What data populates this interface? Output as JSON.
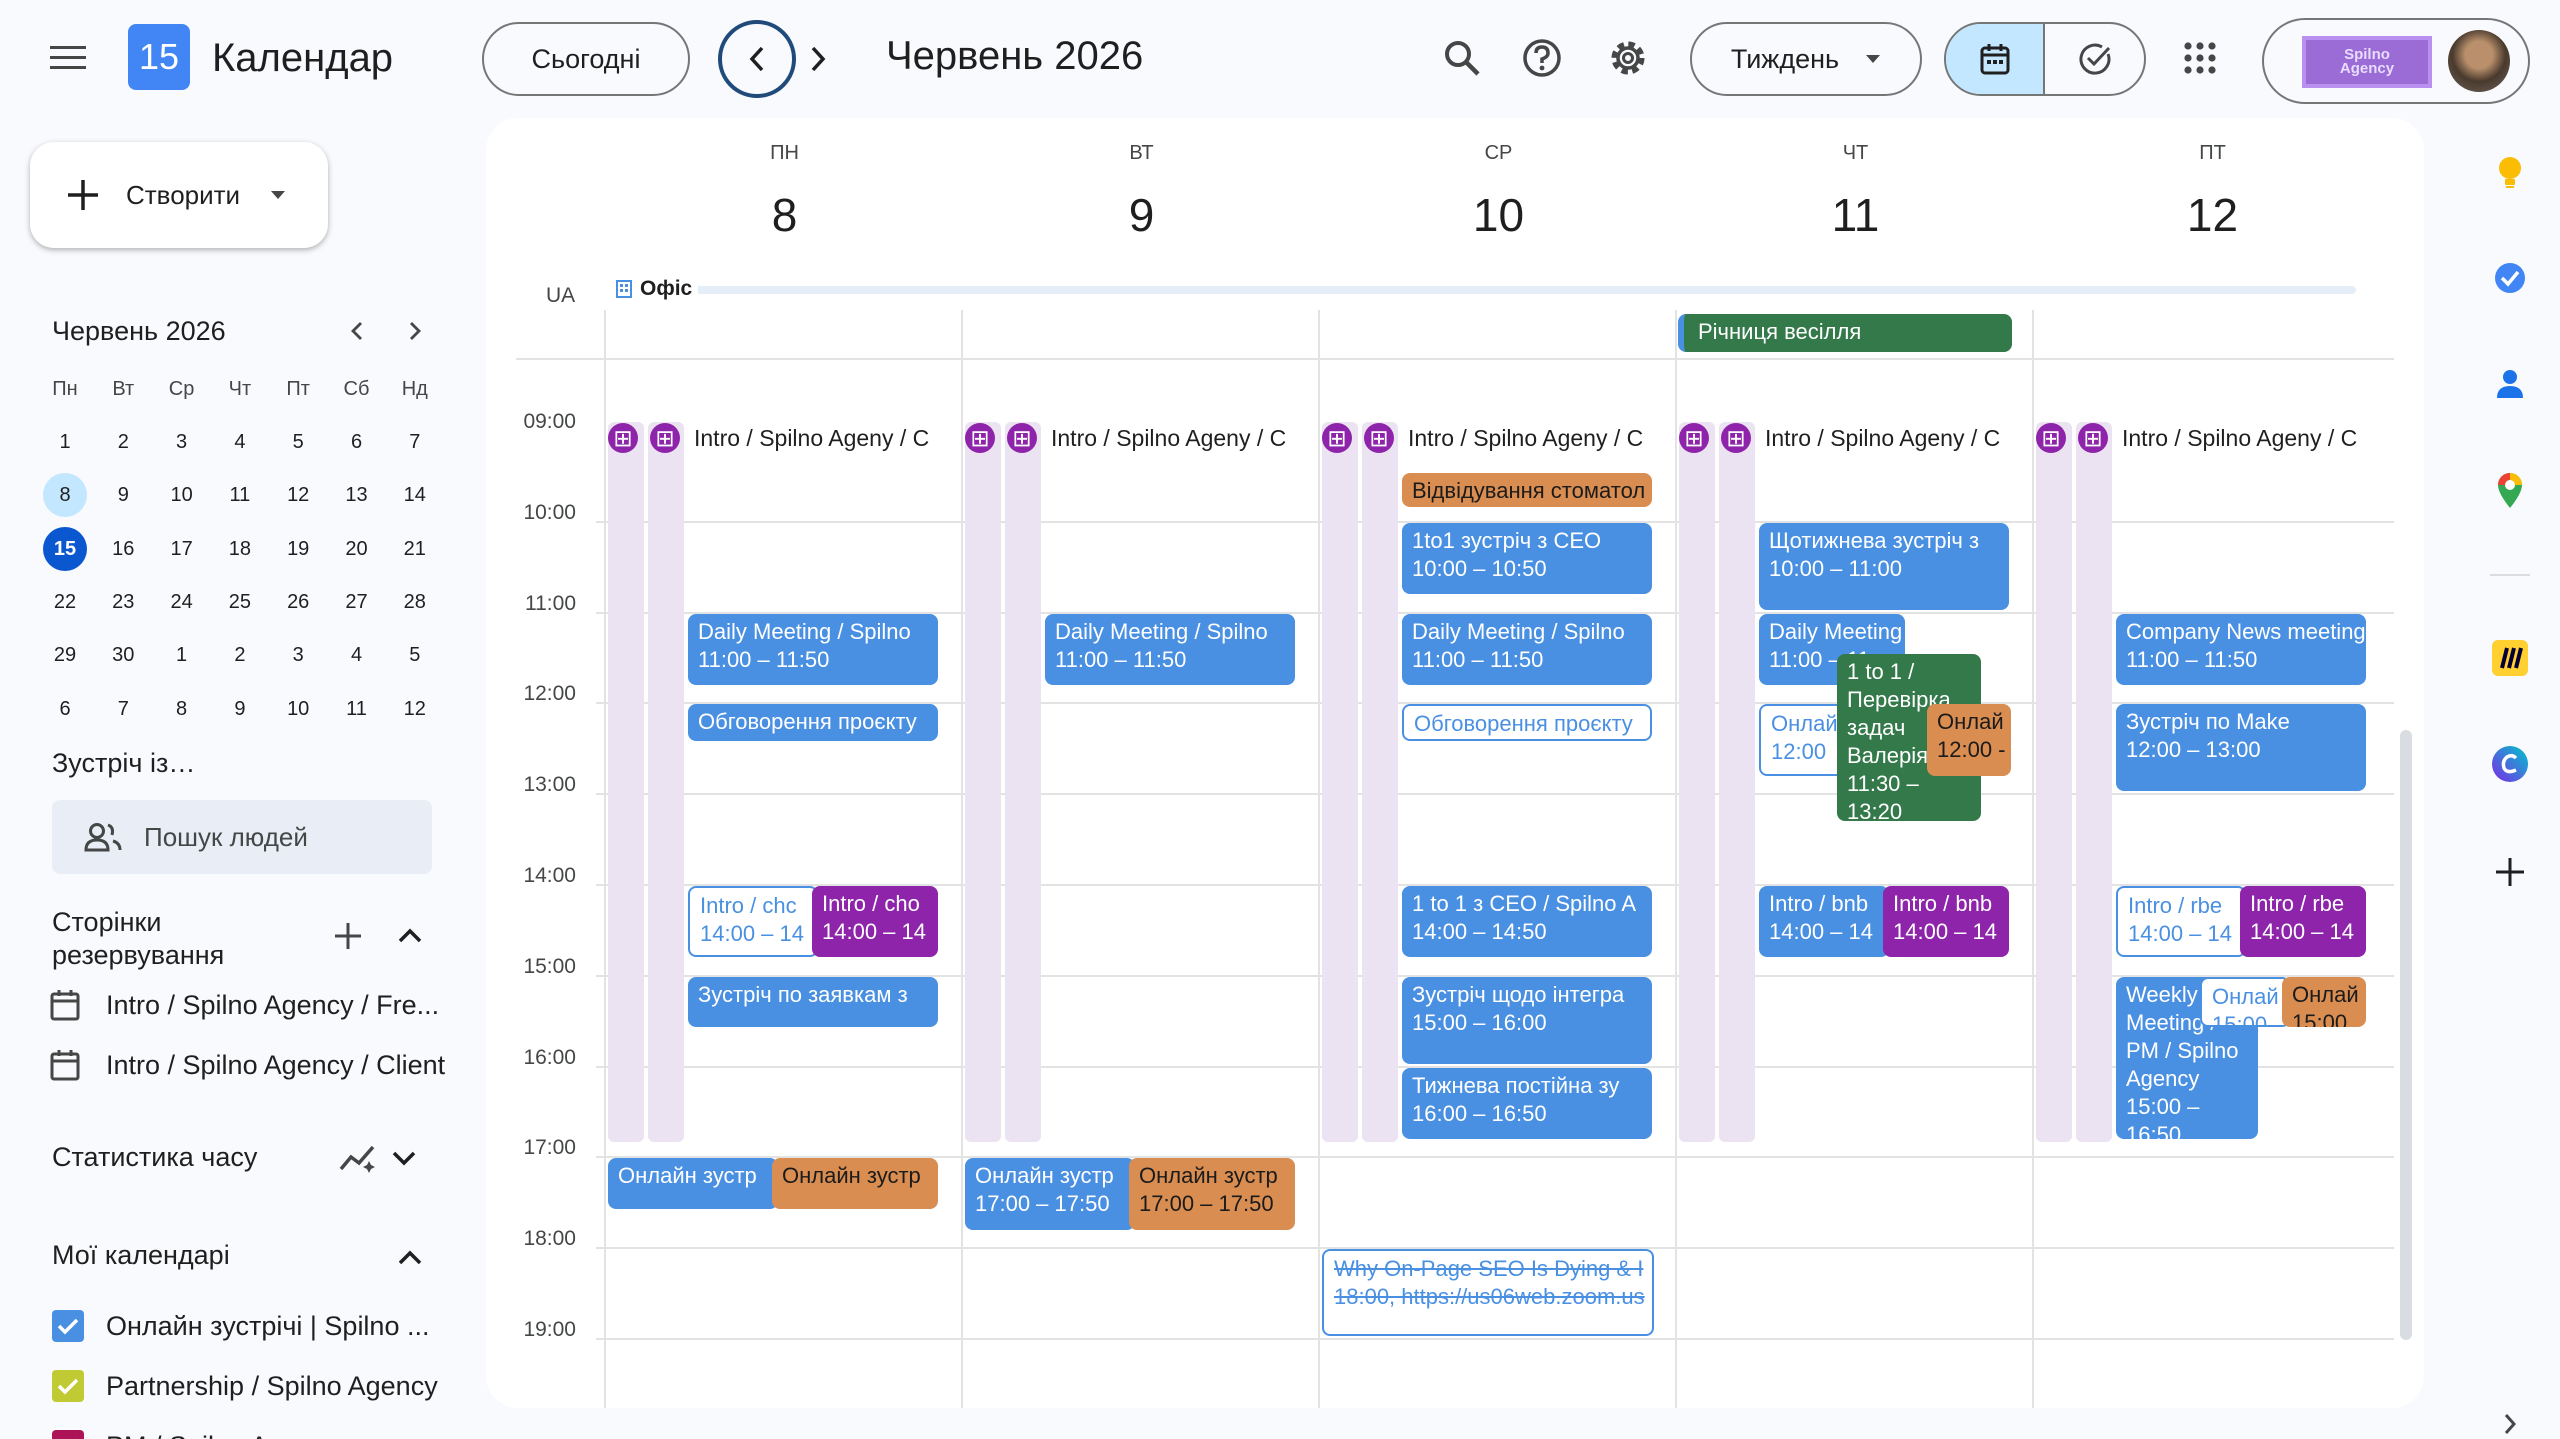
{
  "header": {
    "app_title": "Календар",
    "logo_day": "15",
    "today_button": "Сьогодні",
    "current_period": "Червень 2026",
    "view_select": "Тиждень",
    "account_logo_text": "Spilno Agency"
  },
  "sidebar": {
    "create_button": "Створити",
    "mini_month_title": "Червень 2026",
    "weekday_headers": [
      "Пн",
      "Вт",
      "Ср",
      "Чт",
      "Пт",
      "Сб",
      "Нд"
    ],
    "weeks": [
      [
        "1",
        "2",
        "3",
        "4",
        "5",
        "6",
        "7"
      ],
      [
        "8",
        "9",
        "10",
        "11",
        "12",
        "13",
        "14"
      ],
      [
        "15",
        "16",
        "17",
        "18",
        "19",
        "20",
        "21"
      ],
      [
        "22",
        "23",
        "24",
        "25",
        "26",
        "27",
        "28"
      ],
      [
        "29",
        "30",
        "1",
        "2",
        "3",
        "4",
        "5"
      ],
      [
        "6",
        "7",
        "8",
        "9",
        "10",
        "11",
        "12"
      ]
    ],
    "meet_with_title": "Зустріч із…",
    "people_search_placeholder": "Пошук людей",
    "booking_pages_title": "Сторінки резервування",
    "booking_pages": [
      "Intro / Spilno Agency / Fre...",
      "Intro / Spilno Agency / Client"
    ],
    "time_stats_title": "Статистика часу",
    "my_calendars_title": "Мої календарі",
    "calendars": [
      {
        "label": "Онлайн зустрічі | Spilno ...",
        "color": "#4a90e2"
      },
      {
        "label": "Partnership / Spilno Agency",
        "color": "#c0ca33"
      },
      {
        "label": "PM / Spilno Agency",
        "color": "#ad1457"
      }
    ]
  },
  "week": {
    "timezone": "UA",
    "days": [
      {
        "name": "ПН",
        "num": "8"
      },
      {
        "name": "ВТ",
        "num": "9"
      },
      {
        "name": "СР",
        "num": "10"
      },
      {
        "name": "ЧТ",
        "num": "11"
      },
      {
        "name": "ПТ",
        "num": "12"
      }
    ],
    "working_location": "Офіс",
    "all_day_event": "Річниця весілля",
    "hours": [
      "09:00",
      "10:00",
      "11:00",
      "12:00",
      "13:00",
      "14:00",
      "15:00",
      "16:00",
      "17:00",
      "18:00",
      "19:00"
    ],
    "intro_label": "Intro / Spilno Ageny / C",
    "events": {
      "mon_daily": {
        "title": "Daily Meeting / Spilno",
        "time": "11:00 – 11:50"
      },
      "mon_discuss": {
        "title": "Обговорення проєкту"
      },
      "mon_intro_a": {
        "title": "Intro / chc",
        "time": "14:00 – 14"
      },
      "mon_intro_b": {
        "title": "Intro / cho",
        "time": "14:00 – 14"
      },
      "mon_requests": {
        "title": "Зустріч по заявкам з"
      },
      "mon_online_a": {
        "title": "Онлайн зустр"
      },
      "mon_online_b": {
        "title": "Онлайн зустр"
      },
      "tue_daily": {
        "title": "Daily Meeting / Spilno",
        "time": "11:00 – 11:50"
      },
      "tue_online_a": {
        "title": "Онлайн зустр",
        "time": "17:00 – 17:50"
      },
      "tue_online_b": {
        "title": "Онлайн зустр",
        "time": "17:00 – 17:50"
      },
      "wed_dentist": {
        "title": "Відвідування стоматол"
      },
      "wed_1to1": {
        "title": "1to1 зустріч з CEO",
        "time": "10:00 – 10:50"
      },
      "wed_daily": {
        "title": "Daily Meeting / Spilno",
        "time": "11:00 – 11:50"
      },
      "wed_discuss": {
        "title": "Обговорення проєкту"
      },
      "wed_ceo": {
        "title": "1 to 1 з CEO / Spilno A",
        "time": "14:00 – 14:50"
      },
      "wed_integr": {
        "title": "Зустріч щодо інтегра",
        "time": "15:00 – 16:00"
      },
      "wed_weekly": {
        "title": "Тижнева постійна зу",
        "time": "16:00 – 16:50"
      },
      "wed_seo": {
        "title": "Why On-Page SEO Is Dying & I",
        "time": "18:00, https://us06web.zoom.us"
      },
      "thu_weekly": {
        "title": "Щотижнева зустріч з",
        "time": "10:00 – 11:00"
      },
      "thu_daily": {
        "title": "Daily Meeting",
        "time": "11:00 – 11"
      },
      "thu_online_a": {
        "title": "Онлай",
        "time": "12:00"
      },
      "thu_1to1": {
        "title": "1 to 1 / Перевірка задач Валерія",
        "time": "11:30 – 13:20"
      },
      "thu_online_b": {
        "title": "Онлай",
        "time": "12:00 -"
      },
      "thu_intro_a": {
        "title": "Intro / bnb",
        "time": "14:00 – 14"
      },
      "thu_intro_b": {
        "title": "Intro / bnb",
        "time": "14:00 – 14"
      },
      "fri_news": {
        "title": "Company News meeting",
        "time": "11:00 – 11:50"
      },
      "fri_make": {
        "title": "Зустріч по Make",
        "time": "12:00 – 13:00"
      },
      "fri_intro_a": {
        "title": "Intro / rbe",
        "time": "14:00 – 14"
      },
      "fri_intro_b": {
        "title": "Intro / rbe",
        "time": "14:00 – 14"
      },
      "fri_weekly": {
        "title": "Weekly Meeting / PM / Spilno Agency",
        "time": "15:00 – 16:50"
      },
      "fri_online_a": {
        "title": "Онлай",
        "time": "15:00"
      },
      "fri_online_b": {
        "title": "Онлай",
        "time": "15:00"
      }
    }
  },
  "colors": {
    "accent": "#0b57d0",
    "event_blue": "#4a90e2",
    "event_orange": "#d98d50",
    "event_purple": "#8e24aa",
    "event_green": "#33794a"
  },
  "icons": [
    "menu-icon",
    "search-icon",
    "help-icon",
    "settings-icon",
    "calendar-view-icon",
    "tasks-view-icon",
    "apps-icon",
    "keep-icon",
    "tasks-icon",
    "contacts-icon",
    "maps-icon",
    "miro-icon",
    "canva-icon",
    "plus-icon"
  ]
}
